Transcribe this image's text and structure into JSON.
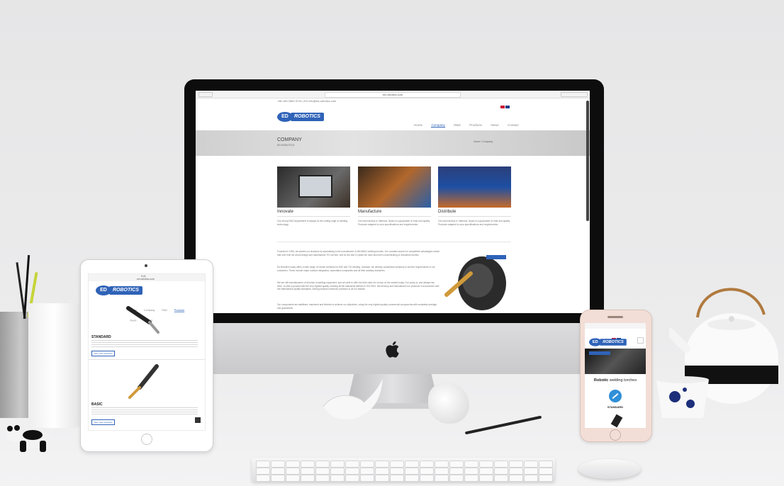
{
  "site": {
    "url": "ed-robotics.com",
    "contact_line": "+86 189 3583 5725  |  ES info@ed-robotics.com",
    "logo_mark": "ED",
    "logo_text": "ROBOTICS",
    "nav": [
      "Home",
      "Company",
      "R&D",
      "Products",
      "News",
      "Contact"
    ],
    "active_nav": "Company",
    "hero_title": "COMPANY",
    "hero_subtitle": "ED-ROBOTICS",
    "breadcrumb": "Home / Company",
    "columns": [
      {
        "title": "Innovate",
        "text": "Our strong R&D department is always at the cutting edge of welding technology."
      },
      {
        "title": "Manufacture",
        "text": "Our main factory in Valencia, Spain is a guarantee of trust and quality. Products adapted to your specifications and requirements."
      },
      {
        "title": "Distribute",
        "text": "Our main factory in Valencia, Spain is a guarantee of trust and quality. Products adapted to your specifications and requirements."
      }
    ],
    "paragraphs": [
      "Founded in 1994, we started our business by specialising in the manufacture of MIG/MAG welding torches. Our constant search for competitive advantages meant that over time we would design and manufacture TIG torches, and for the last 10 years we have also been concentrating on industrial robotics.",
      "Ed-Robotics today offers a wide range of robotic solutions for MIG and TIG welding. Likewise, we develop customised solutions to suit the requirements of our customers. These include major robotics integrators, automation companies and all their auxiliary industries.",
      "We are still manufacturers of all kinds of welding equipment, and are able to offer the best value for money on the market today. Our policy is, and always has been, to offer a product with the very highest quality, meeting all the standards defined in ISO 9001. We develop and manufacture our products in accordance with the international quality standards, striving towards maximum precision in all our articles.",
      "Our components are stabilised, machined and finished to achieve our objectives, using the very highest quality commercial components with worldwide prestige and guarantees."
    ]
  },
  "ipad": {
    "status_time": "9:41",
    "url": "ed-robotics.com",
    "products": [
      {
        "name": "STANDARD",
        "button": "See more products"
      },
      {
        "name": "BASIC",
        "button": "See more products"
      }
    ]
  },
  "iphone": {
    "heading_bold": "Robotic",
    "heading_rest": " welding torches",
    "product_label": "STANDARD"
  },
  "colors": {
    "brand_blue": "#2f63b8",
    "teapot_handle": "#b07a3e"
  }
}
